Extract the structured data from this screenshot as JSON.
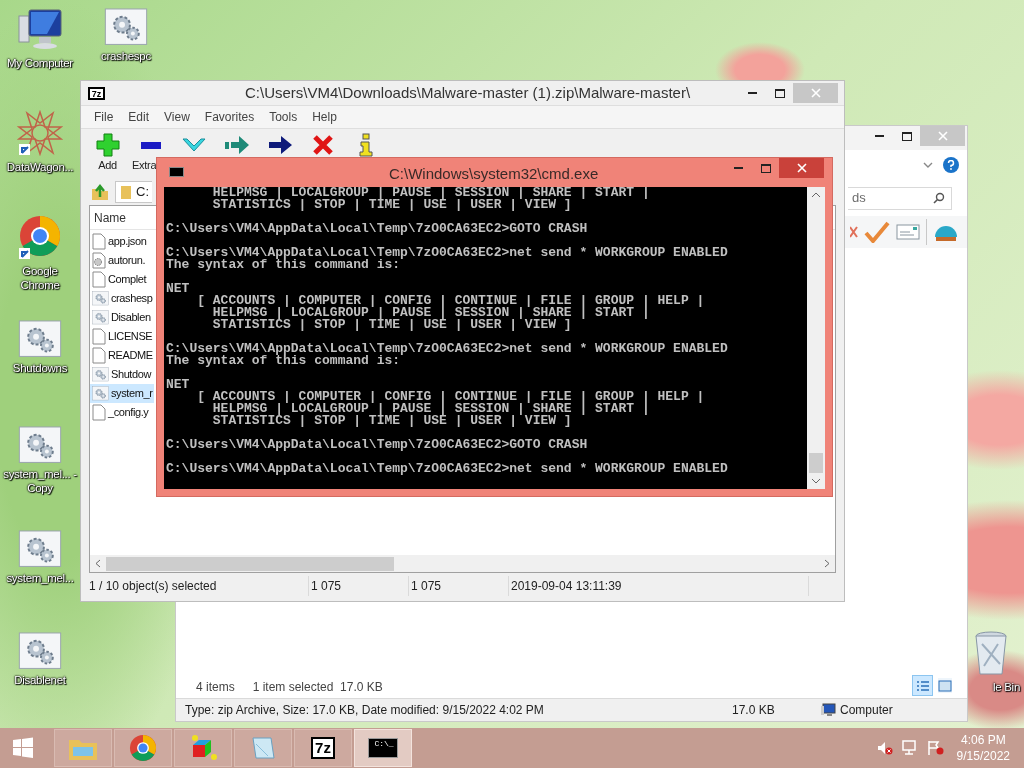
{
  "desktop_icons": [
    {
      "label": "My Computer",
      "kind": "computer"
    },
    {
      "label": "crashespc",
      "kind": "gears"
    },
    {
      "label": "DataWagon...",
      "kind": "star"
    },
    {
      "label": "Google Chrome",
      "kind": "chrome"
    },
    {
      "label": "Shutdowns",
      "kind": "gears"
    },
    {
      "label": "system_mel... - Copy",
      "kind": "gears"
    },
    {
      "label": "system_mel...",
      "kind": "gears"
    },
    {
      "label": "Disablenet",
      "kind": "gears"
    },
    {
      "label": "le Bin",
      "kind": "recycle"
    }
  ],
  "explorer": {
    "search": {
      "value": "ds"
    },
    "item_count": "4 items",
    "selection": "1 item selected  17.0 KB",
    "status_bar": {
      "details": "Type: zip Archive, Size: 17.0 KB, Date modified: 9/15/2022 4:02 PM",
      "size": "17.0 KB",
      "location": "Computer"
    },
    "views": [
      {
        "kind": "details",
        "selected": true
      },
      {
        "kind": "thumbnails",
        "selected": false
      }
    ]
  },
  "sevenzip": {
    "app_icon": "7z",
    "title": "C:\\Users\\VM4\\Downloads\\Malware-master (1).zip\\Malware-master\\",
    "menu": [
      "File",
      "Edit",
      "View",
      "Favorites",
      "Tools",
      "Help"
    ],
    "toolbar": [
      {
        "kind": "add",
        "label": "Add"
      },
      {
        "kind": "extract",
        "label": "Extra"
      },
      {
        "kind": "test"
      },
      {
        "kind": "copy"
      },
      {
        "kind": "move"
      },
      {
        "kind": "delete"
      },
      {
        "kind": "info"
      }
    ],
    "address": "C:",
    "column": "Name",
    "files": [
      {
        "name": "app.json",
        "kind": "file",
        "selected": false
      },
      {
        "name": "autorun.",
        "kind": "config",
        "selected": false
      },
      {
        "name": "Complet",
        "kind": "file",
        "selected": false
      },
      {
        "name": "crashesp",
        "kind": "gears",
        "selected": false
      },
      {
        "name": "Disablen",
        "kind": "gears",
        "selected": false
      },
      {
        "name": "LICENSE",
        "kind": "file",
        "selected": false
      },
      {
        "name": "README",
        "kind": "file",
        "selected": false
      },
      {
        "name": "Shutdow",
        "kind": "gears",
        "selected": false
      },
      {
        "name": "system_r",
        "kind": "gears",
        "selected": true
      },
      {
        "name": "_config.y",
        "kind": "file",
        "selected": false
      }
    ],
    "status_bar": [
      "1 / 10 object(s) selected",
      "1 075",
      "1 075",
      "2019-09-04 13:11:39"
    ]
  },
  "cmd": {
    "title": "C:\\Windows\\system32\\cmd.exe",
    "blocks": [
      [
        "      HELPMSG | LOCALGROUP | PAUSE | SESSION | SHARE | START |",
        "      STATISTICS | STOP | TIME | USE | USER | VIEW ]"
      ],
      [
        "C:\\Users\\VM4\\AppData\\Local\\Temp\\7zO0CA63EC2>GOTO CRASH"
      ],
      [
        "C:\\Users\\VM4\\AppData\\Local\\Temp\\7zO0CA63EC2>net send * WORKGROUP ENABLED",
        "The syntax of this command is:"
      ],
      [
        "NET",
        "    [ ACCOUNTS | COMPUTER | CONFIG | CONTINUE | FILE | GROUP | HELP |",
        "      HELPMSG | LOCALGROUP | PAUSE | SESSION | SHARE | START |",
        "      STATISTICS | STOP | TIME | USE | USER | VIEW ]"
      ],
      [
        "C:\\Users\\VM4\\AppData\\Local\\Temp\\7zO0CA63EC2>net send * WORKGROUP ENABLED",
        "The syntax of this command is:"
      ],
      [
        "NET",
        "    [ ACCOUNTS | COMPUTER | CONFIG | CONTINUE | FILE | GROUP | HELP |",
        "      HELPMSG | LOCALGROUP | PAUSE | SESSION | SHARE | START |",
        "      STATISTICS | STOP | TIME | USE | USER | VIEW ]"
      ],
      [
        "C:\\Users\\VM4\\AppData\\Local\\Temp\\7zO0CA63EC2>GOTO CRASH"
      ],
      [
        "C:\\Users\\VM4\\AppData\\Local\\Temp\\7zO0CA63EC2>net send * WORKGROUP ENABLED"
      ]
    ]
  },
  "taskbar": {
    "apps": [
      {
        "kind": "explorer",
        "selected": false
      },
      {
        "kind": "chrome",
        "selected": false
      },
      {
        "kind": "cube",
        "selected": false
      },
      {
        "kind": "notepad",
        "selected": false
      },
      {
        "kind": "sevenzip",
        "label": "7z",
        "selected": false
      },
      {
        "kind": "cmd",
        "label": "C:\\_",
        "selected": true
      }
    ],
    "time": "4:06 PM",
    "date": "9/15/2022"
  }
}
